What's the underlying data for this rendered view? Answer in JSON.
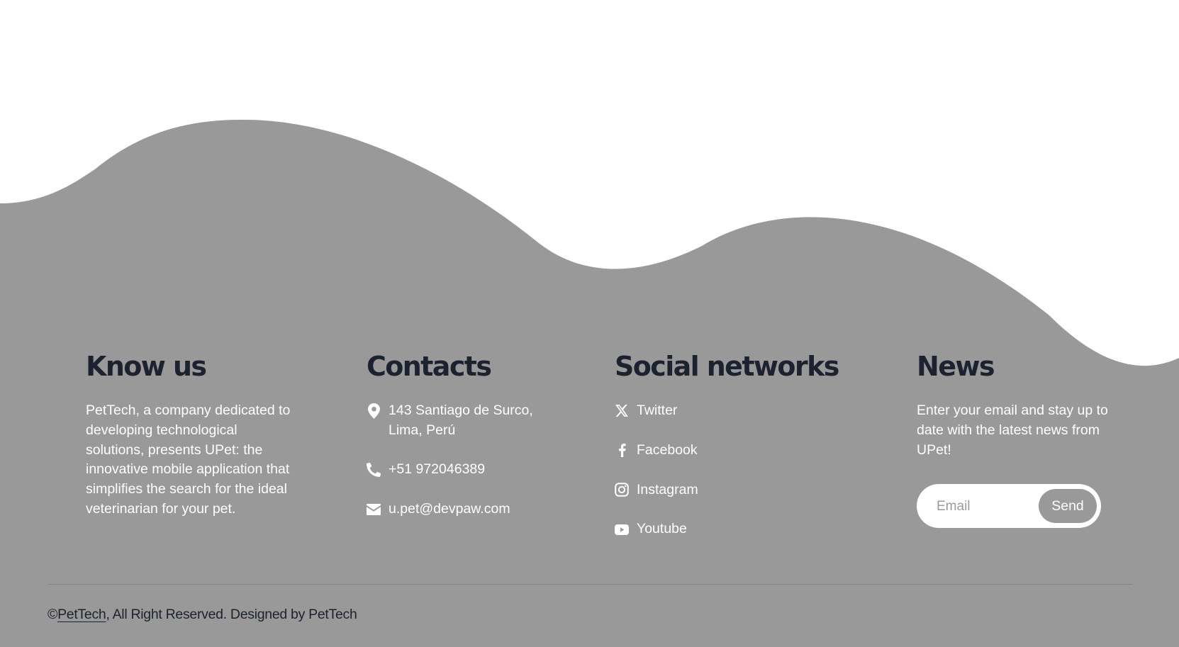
{
  "colors": {
    "footer_bg": "#999999",
    "heading": "#1c2230",
    "body_text": "#ffffff",
    "page_bg": "#ffffff"
  },
  "know_us": {
    "title": "Know us",
    "text": "PetTech, a company dedicated to developing technological solutions, presents UPet: the innovative mobile application that simplifies the search for the ideal veterinarian for your pet."
  },
  "contacts": {
    "title": "Contacts",
    "address_line1": "143 Santiago de Surco,",
    "address_line2": "Lima, Perú",
    "phone": "+51 972046389",
    "email": "u.pet@devpaw.com",
    "icons": [
      "location-pin-icon",
      "phone-icon",
      "envelope-icon"
    ]
  },
  "social": {
    "title": "Social networks",
    "items": [
      {
        "label": "Twitter",
        "icon": "x-twitter-icon"
      },
      {
        "label": "Facebook",
        "icon": "facebook-icon"
      },
      {
        "label": "Instagram",
        "icon": "instagram-icon"
      },
      {
        "label": "Youtube",
        "icon": "youtube-icon"
      }
    ]
  },
  "news": {
    "title": "News",
    "text": "Enter your email and stay up to date with the latest news from UPet!",
    "email_placeholder": "Email",
    "send_label": "Send"
  },
  "footer": {
    "copyright_symbol": "©",
    "brand_link": "PetTech",
    "rest": ", All Right Reserved. Designed by PetTech"
  }
}
